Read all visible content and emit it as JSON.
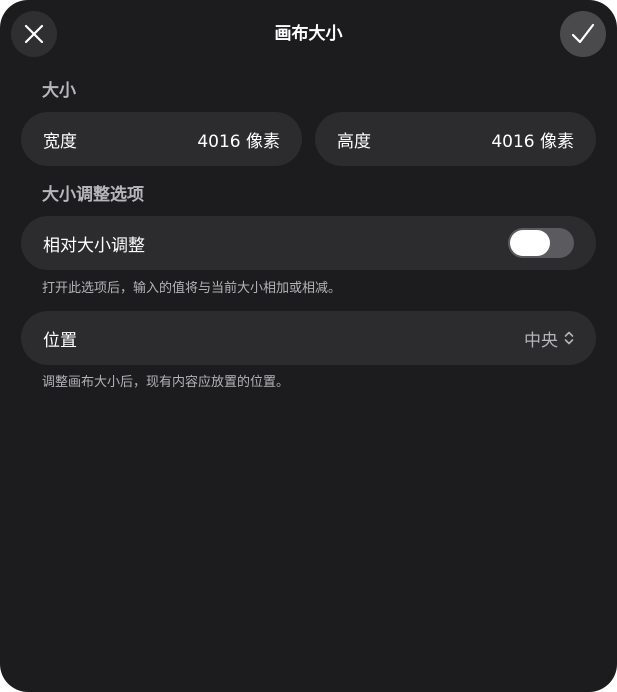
{
  "header": {
    "title": "画布大小",
    "close_icon": "close-icon",
    "confirm_icon": "checkmark-icon"
  },
  "size_section": {
    "label": "大小",
    "width": {
      "label": "宽度",
      "value": "4016 像素"
    },
    "height": {
      "label": "高度",
      "value": "4016 像素"
    }
  },
  "options_section": {
    "label": "大小调整选项",
    "relative": {
      "label": "相对大小调整",
      "enabled": false,
      "hint": "打开此选项后，输入的值将与当前大小相加或相减。"
    },
    "position": {
      "label": "位置",
      "value": "中央",
      "icon": "chevron-up-down-icon",
      "hint": "调整画布大小后，现有内容应放置的位置。"
    }
  },
  "colors": {
    "background": "#1c1c1e",
    "row": "#2c2c2e",
    "secondary_text": "#b3b3b8"
  }
}
